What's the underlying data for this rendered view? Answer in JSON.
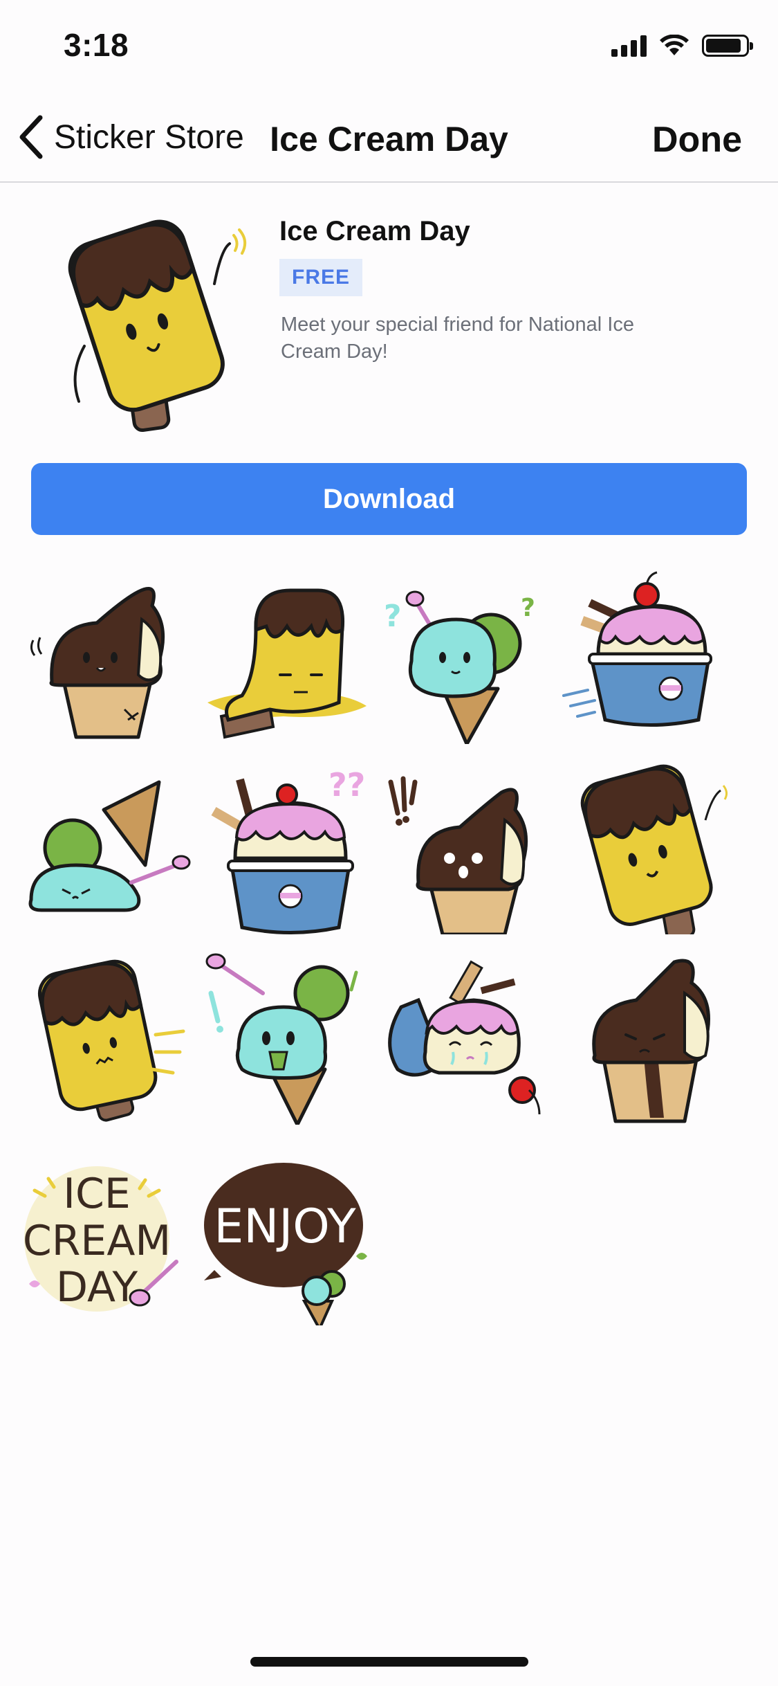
{
  "status": {
    "time": "3:18"
  },
  "nav": {
    "back_label": "Sticker Store",
    "title": "Ice Cream Day",
    "done_label": "Done"
  },
  "pack": {
    "title": "Ice Cream Day",
    "price": "FREE",
    "description": "Meet your special friend for National Ice Cream Day!"
  },
  "download_label": "Download",
  "stickers": [
    {
      "name": "Soft serve chocolate"
    },
    {
      "name": "Melting popsicle"
    },
    {
      "name": "Mint scoop confused"
    },
    {
      "name": "Sundae cup running"
    },
    {
      "name": "Dropped cone"
    },
    {
      "name": "Sundae cup thinking"
    },
    {
      "name": "Soft serve surprised"
    },
    {
      "name": "Popsicle waving"
    },
    {
      "name": "Popsicle running"
    },
    {
      "name": "Mint scoop excited"
    },
    {
      "name": "Spilled cup crying"
    },
    {
      "name": "Soft serve sad"
    },
    {
      "name": "Ice cream day lettering",
      "text": [
        "ICE",
        "CREAM",
        "DAY"
      ]
    },
    {
      "name": "Enjoy bubble",
      "text": "ENJOY"
    }
  ],
  "colors": {
    "accent": "#3d82f1",
    "chocolate": "#4a2c1f",
    "vanilla": "#f6f0cf",
    "mint": "#8ee3dd",
    "matcha": "#7ab446",
    "cone": "#d9b07a",
    "popsicle": "#e9cd3a",
    "pink": "#e9a5e0",
    "cup": "#5e93c8"
  }
}
